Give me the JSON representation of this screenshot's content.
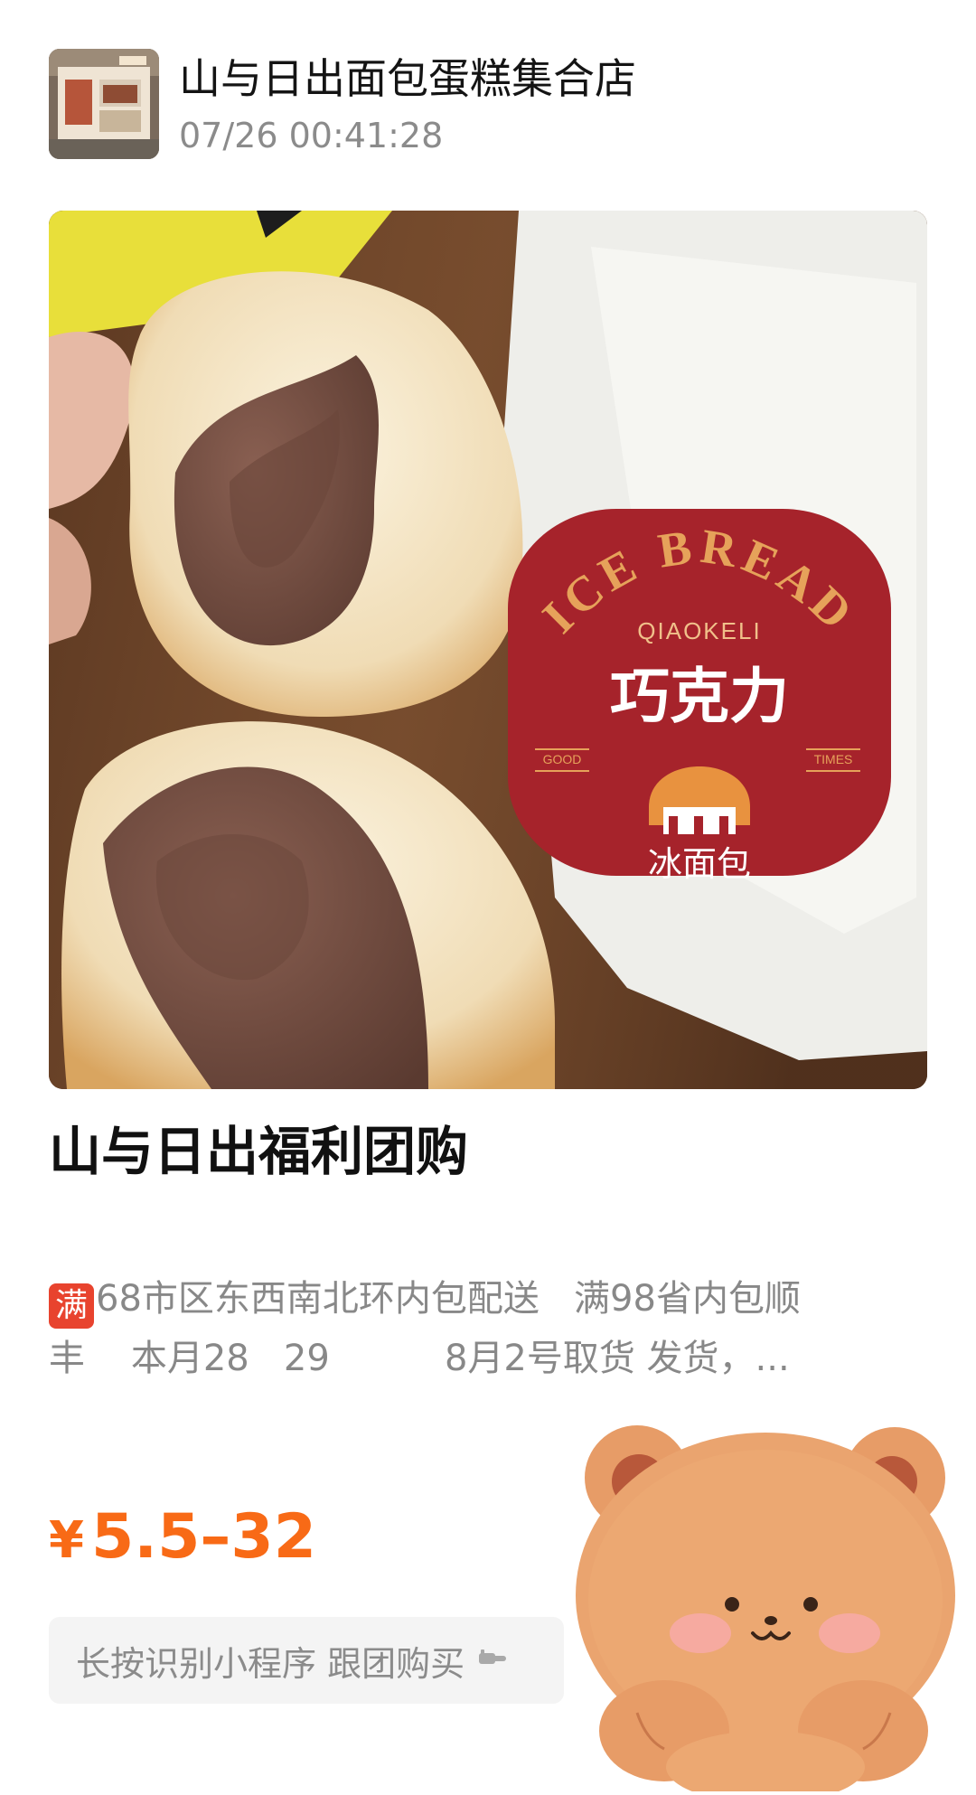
{
  "header": {
    "shop_name": "山与日出面包蛋糕集合店",
    "timestamp": "07/26 00:41:28",
    "avatar_icon": "storefront-avatar"
  },
  "photo": {
    "label_line1": "ICE BREAD",
    "label_line2": "QIAOKELI",
    "label_main": "巧克力",
    "label_left": "GOOD",
    "label_right": "TIMES",
    "label_bottom": "冰面包"
  },
  "title": "山与日出福利团购",
  "description": {
    "badge": "满",
    "line1": "68市区东西南北环内包配送   满98省内包顺",
    "line2": "丰    本月28   29          8月2号取货 发货，..."
  },
  "price": {
    "currency": "¥",
    "range": "5.5–32"
  },
  "action": {
    "label": "长按识别小程序 跟团购买",
    "icon": "pointing-hand-icon"
  },
  "sticker": {
    "icon": "bear-sticker"
  },
  "colors": {
    "price": "#f86a16",
    "badge": "#e8432e",
    "label_red": "#a6232b",
    "label_gold": "#e6a25a"
  }
}
